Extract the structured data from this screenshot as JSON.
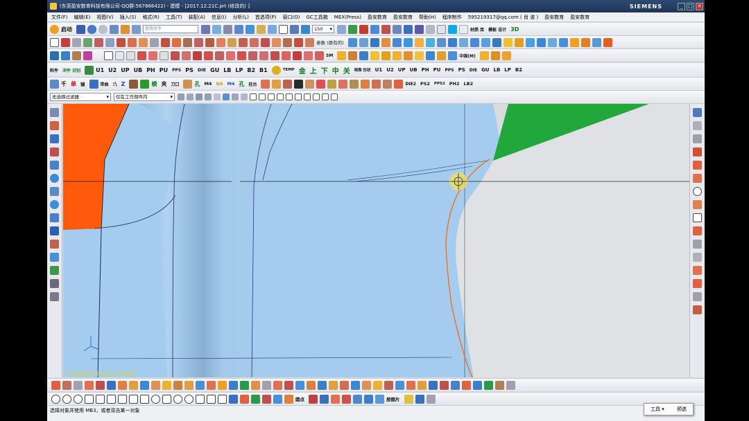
{
  "window": {
    "title": "(东莞盈安数育科技有限公司-QQ群:567866422) - 建模 - [2017.12.21C.prt (修改的) ]",
    "brand": "SIEMENS",
    "controls": [
      "_",
      "□",
      "✕"
    ]
  },
  "menu": [
    "文件(F)",
    "编辑(E)",
    "视图(V)",
    "插入(S)",
    "格式(R)",
    "工具(T)",
    "装配(A)",
    "信息(I)",
    "分析(L)",
    "首选项(P)",
    "窗口(O)",
    "GC工具箱",
    "MEX(Press)",
    "盈安数育",
    "盈安数育",
    "帮助(H)",
    "程序制作",
    "595219317@qq.com ( 肖 波 )",
    "盈安数育",
    "盈安数育"
  ],
  "toolbar1": {
    "start_label": "启动",
    "search_placeholder": "查找命令",
    "zoom_value": "150",
    "right_labels": [
      "材质\n库",
      "模板\n设计",
      "3D"
    ]
  },
  "toolbar2": {
    "label": "参数 (原有的)"
  },
  "toolbar3": {
    "labels": [
      "中国(M)",
      "SM"
    ]
  },
  "toolbar4": {
    "left_labels": [
      "料件",
      "冲件\n识别",
      "U1",
      "U2",
      "UP",
      "UB",
      "PH",
      "PU",
      "PPS",
      "PS",
      "DIE",
      "GU",
      "LB",
      "LP",
      "B2",
      "B1",
      "TEMP",
      "金",
      "上",
      "下",
      "中",
      "关",
      "特殊\n形状"
    ],
    "right_labels": [
      "U1",
      "U2",
      "UP",
      "UB",
      "PH",
      "PU",
      "PPS",
      "PS",
      "DIE",
      "GU",
      "LB",
      "LP",
      "B2"
    ]
  },
  "toolbar5": {
    "labels": [
      "千",
      "单",
      "镜",
      "带曲",
      ":\\",
      "Z",
      "模",
      "夹",
      "刀口",
      "孔",
      "M4",
      "N4",
      "M4",
      "孔",
      "柱台"
    ],
    "right_labels": [
      "DIE2",
      "PS2",
      "PPS2",
      "PH2",
      "LB2"
    ]
  },
  "selection_bar": {
    "filter": "无选择过滤器",
    "scope": "仅在工作部件内"
  },
  "viewport": {
    "watermark": "东莞盈安数育 技术支持 盈安数育"
  },
  "bottom_toolbar2": {
    "label": "圆点"
  },
  "bottom_toolbar2_right": {
    "label": "按图片"
  },
  "status": {
    "prompt": "选择对象并使用 MB3，或者双击某一对象"
  },
  "popup": {
    "items": [
      "工具 ▾",
      "预选"
    ]
  },
  "colors": {
    "title_bg": "#1d3457",
    "surface_blue": "#a4ccee",
    "face_orange": "#ff5a0a",
    "face_green": "#22a83a",
    "face_gray": "#d8dbdf"
  }
}
